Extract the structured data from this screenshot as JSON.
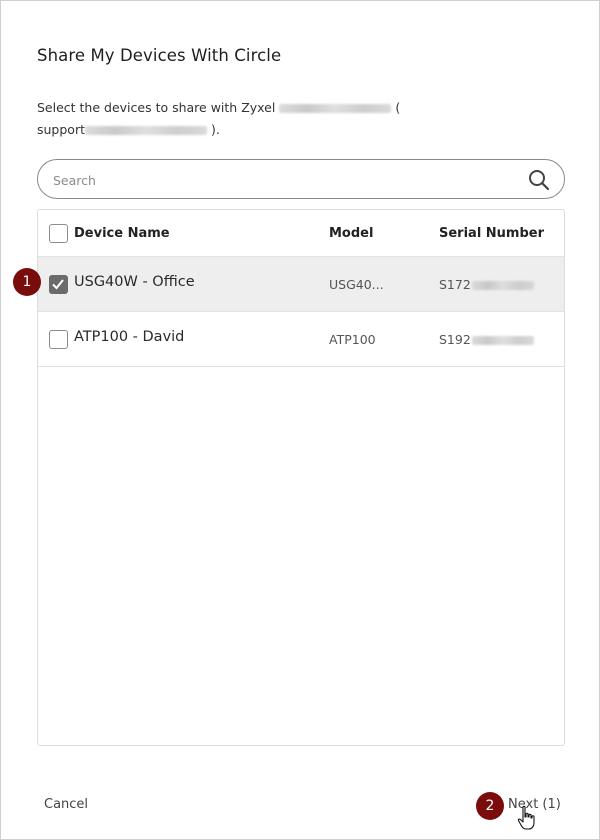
{
  "dialog": {
    "title": "Share My Devices With Circle",
    "description_prefix": "Select the devices to share with Zyxel",
    "description_paren_open": "(",
    "description_email_prefix": "support",
    "description_email_suffix": ").",
    "search": {
      "placeholder": "Search",
      "value": "",
      "icon": "search-icon"
    },
    "table": {
      "headers": {
        "device_name": "Device Name",
        "model": "Model",
        "serial": "Serial Number"
      },
      "rows": [
        {
          "name": "USG40W - Office",
          "model": "USG40...",
          "serial_prefix": "S172",
          "checked": true
        },
        {
          "name": "ATP100 - David",
          "model": "ATP100",
          "serial_prefix": "S192",
          "checked": false
        }
      ]
    },
    "footer": {
      "cancel_label": "Cancel",
      "next_label": "Next (1)"
    }
  },
  "callouts": {
    "step1": "1",
    "step2": "2",
    "color": "#7a0c0c"
  }
}
